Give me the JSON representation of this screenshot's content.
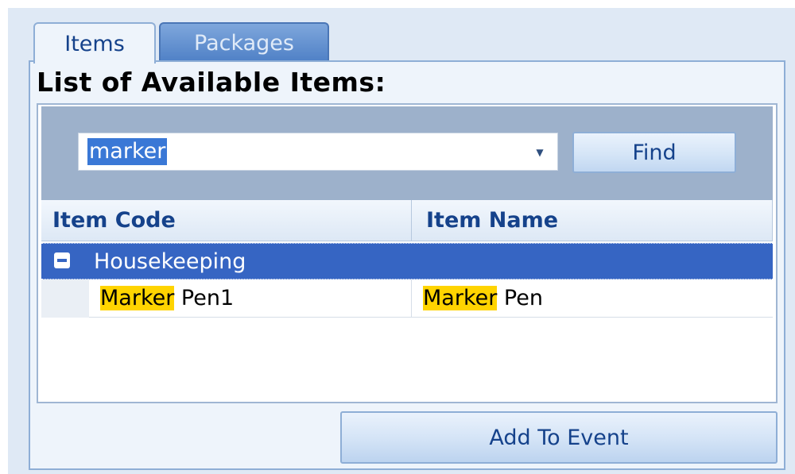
{
  "tabs": [
    {
      "label": "Items",
      "selected": true
    },
    {
      "label": "Packages",
      "selected": false
    }
  ],
  "panel": {
    "title": "List of Available Items:"
  },
  "search": {
    "value": "marker"
  },
  "find_button": {
    "label": "Find"
  },
  "grid": {
    "columns": [
      "Item Code",
      "Item Name"
    ],
    "group": {
      "label": "Housekeeping",
      "expanded": true
    },
    "rows": [
      {
        "code_match": "Marker",
        "code_rest": " Pen1",
        "name_match": "Marker",
        "name_rest": " Pen"
      }
    ]
  },
  "add_button": {
    "label": "Add To Event"
  },
  "colors": {
    "highlight": "#ffd400",
    "group_row": "#3665c3",
    "selection": "#3a78d6",
    "text_blue": "#15428b"
  }
}
